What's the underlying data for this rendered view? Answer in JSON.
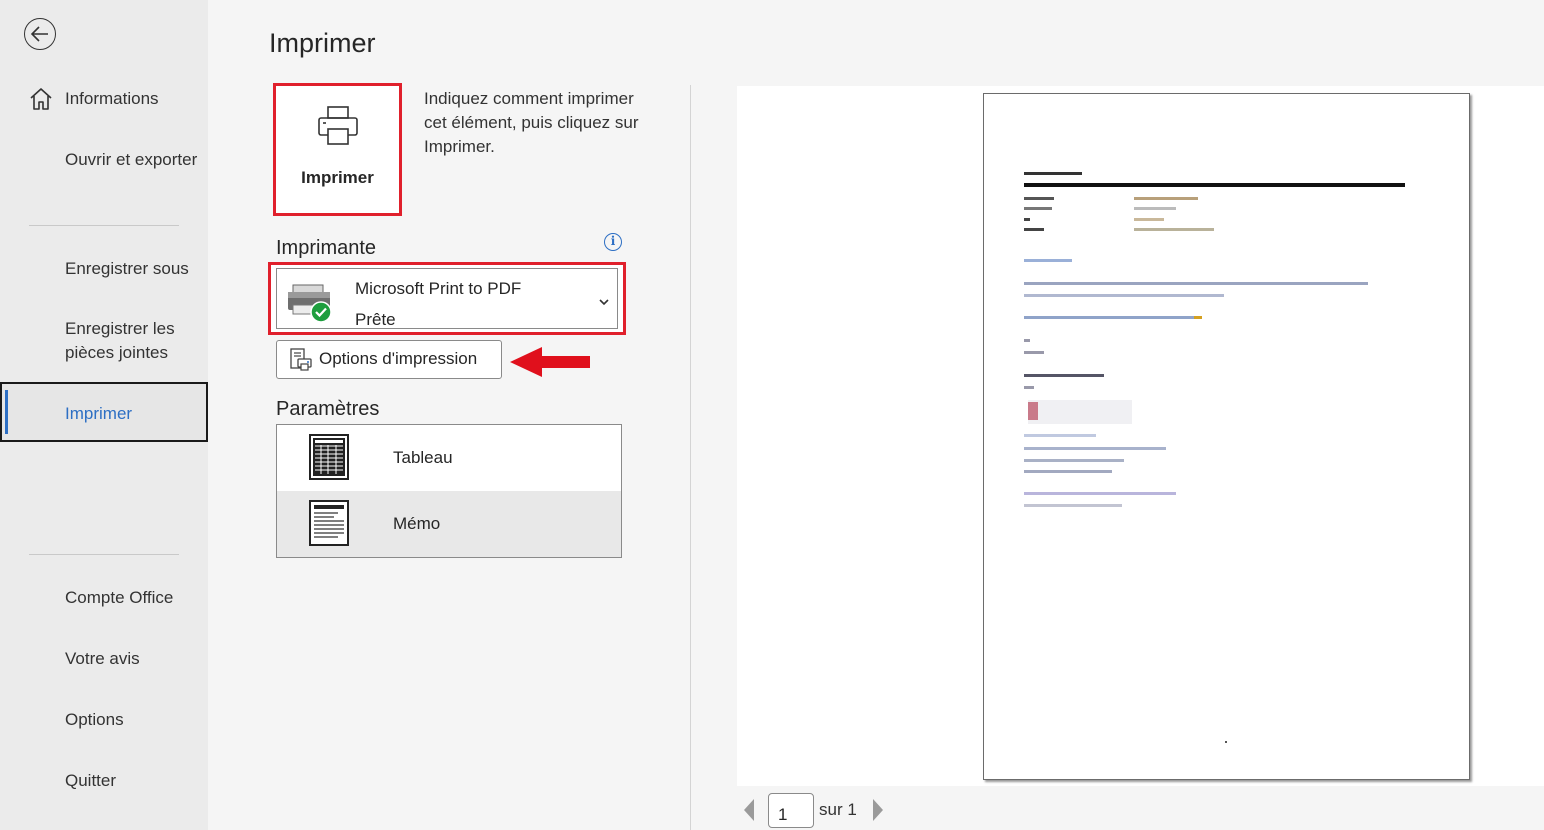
{
  "sidebar": {
    "items": [
      {
        "label": "Informations"
      },
      {
        "label": "Ouvrir et exporter"
      },
      {
        "label": "Enregistrer sous"
      },
      {
        "label": "Enregistrer les pièces jointes"
      },
      {
        "label": "Imprimer"
      },
      {
        "label": "Compte Office"
      },
      {
        "label": "Votre avis"
      },
      {
        "label": "Options"
      },
      {
        "label": "Quitter"
      }
    ],
    "selected": "Imprimer"
  },
  "main": {
    "title": "Imprimer",
    "print_button_label": "Imprimer",
    "description": "Indiquez comment imprimer cet élément, puis cliquez sur Imprimer.",
    "printer_section_title": "Imprimante",
    "printer": {
      "name": "Microsoft Print to PDF",
      "status": "Prête"
    },
    "print_options_label": "Options d'impression",
    "settings_section_title": "Paramètres",
    "styles": [
      {
        "label": "Tableau",
        "icon": "table-style-icon"
      },
      {
        "label": "Mémo",
        "icon": "memo-style-icon"
      }
    ],
    "selected_style": "Mémo"
  },
  "preview": {
    "current_page": "1",
    "total_label": "sur 1"
  },
  "colors": {
    "accent": "#2d6fc4",
    "highlight_red": "#e0202c"
  }
}
